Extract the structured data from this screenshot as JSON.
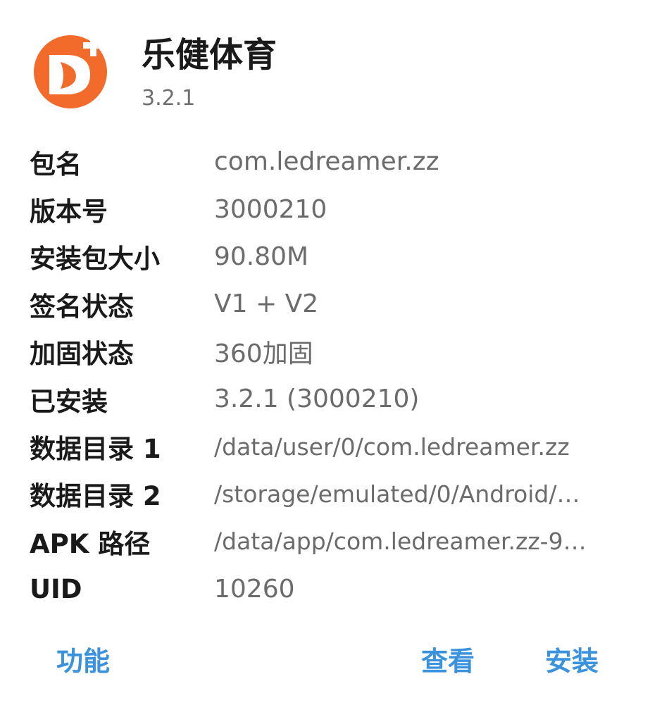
{
  "app": {
    "name": "乐健体育",
    "version": "3.2.1",
    "icon": "app-logo-icon",
    "icon_colors": {
      "primary": "#f26b2a",
      "secondary": "#ffffff"
    }
  },
  "info": [
    {
      "label": "包名",
      "value": "com.ledreamer.zz"
    },
    {
      "label": "版本号",
      "value": "3000210"
    },
    {
      "label": "安装包大小",
      "value": "90.80M"
    },
    {
      "label": "签名状态",
      "value": "V1 + V2"
    },
    {
      "label": "加固状态",
      "value": "360加固"
    },
    {
      "label": "已安装",
      "value": "3.2.1 (3000210)"
    },
    {
      "label": "数据目录 1",
      "value": "/data/user/0/com.ledreamer.zz"
    },
    {
      "label": "数据目录 2",
      "value": "/storage/emulated/0/Android/…"
    },
    {
      "label": "APK 路径",
      "value": "/data/app/com.ledreamer.zz-9…"
    },
    {
      "label": "UID",
      "value": "10260"
    }
  ],
  "actions": {
    "function_label": "功能",
    "view_label": "查看",
    "install_label": "安装"
  },
  "colors": {
    "accent": "#3b92dd",
    "label_text": "#1a1a1a",
    "value_text": "#6b6b6b"
  }
}
